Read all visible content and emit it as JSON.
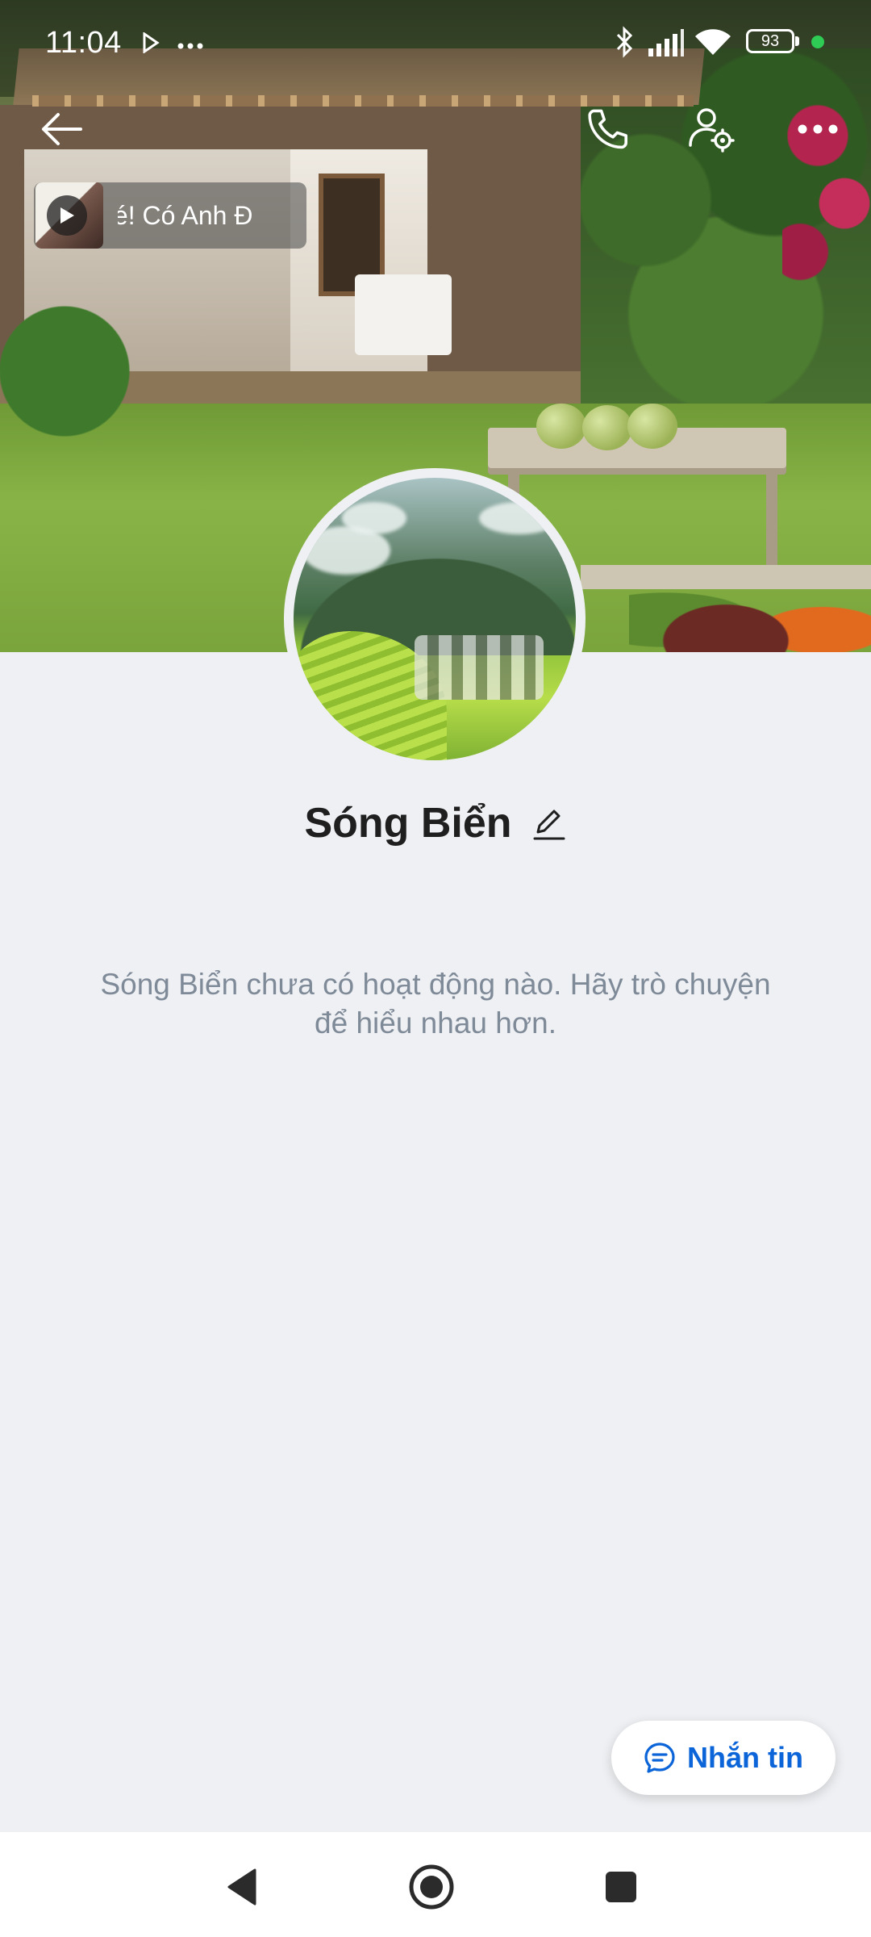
{
  "status_bar": {
    "time": "11:04",
    "battery": "93",
    "icons": [
      "play-store-icon",
      "more-dots-icon",
      "bluetooth-icon",
      "signal-icon",
      "wifi-icon",
      "battery-icon",
      "privacy-dot-icon"
    ]
  },
  "header": {
    "actions": [
      "back-arrow-icon",
      "phone-call-icon",
      "profile-settings-icon",
      "more-icon"
    ]
  },
  "music": {
    "text": "Nhé! Có Anh Đ"
  },
  "profile": {
    "name": "Sóng Biển",
    "empty_message": "Sóng Biển chưa có hoạt động nào. Hãy trò chuyện để hiểu nhau hơn."
  },
  "actions": {
    "message_label": "Nhắn tin"
  },
  "colors": {
    "accent": "#0b64d8",
    "background": "#eef0f3",
    "name_text": "#1f1f1f",
    "muted_text": "#7f8a98"
  }
}
